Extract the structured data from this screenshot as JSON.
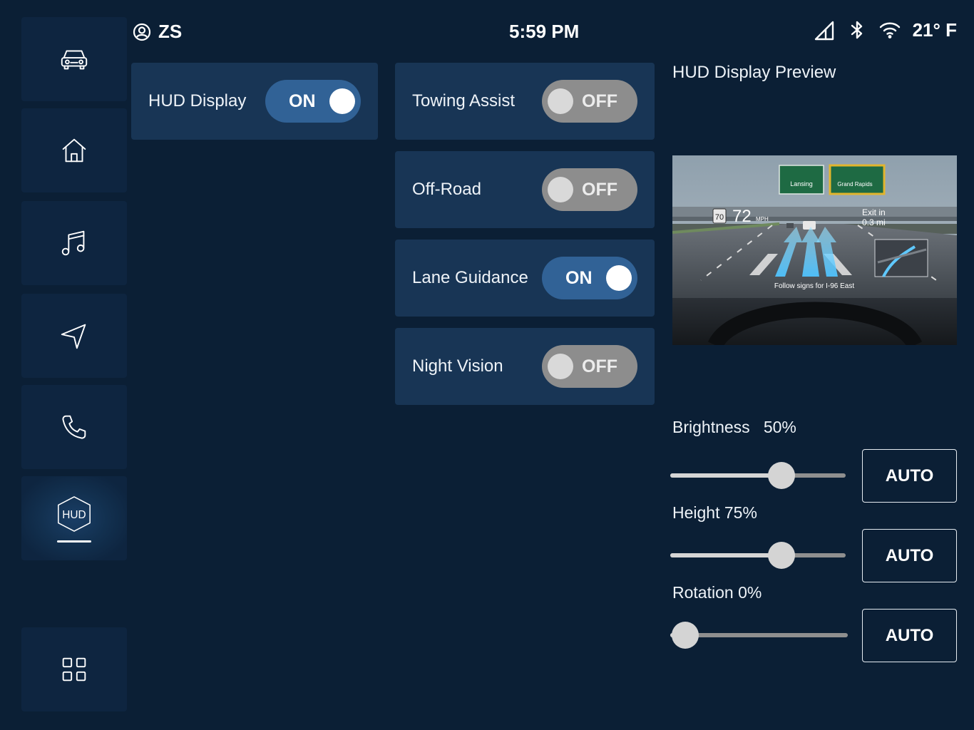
{
  "status_bar": {
    "user_initials": "ZS",
    "time": "5:59 PM",
    "temperature": "21° F"
  },
  "sidebar": {
    "items": [
      {
        "name": "car",
        "icon": "car-icon"
      },
      {
        "name": "home",
        "icon": "home-icon"
      },
      {
        "name": "music",
        "icon": "music-note-icon"
      },
      {
        "name": "navigation",
        "icon": "navigation-arrow-icon"
      },
      {
        "name": "phone",
        "icon": "phone-icon"
      },
      {
        "name": "hud",
        "icon": "hud-hexagon-icon",
        "label": "HUD",
        "active": true
      },
      {
        "name": "apps",
        "icon": "apps-grid-icon"
      }
    ]
  },
  "toggles": {
    "hud_display": {
      "label": "HUD Display",
      "state": "ON"
    },
    "towing_assist": {
      "label": "Towing Assist",
      "state": "OFF"
    },
    "off_road": {
      "label": "Off-Road",
      "state": "OFF"
    },
    "lane_guidance": {
      "label": "Lane Guidance",
      "state": "ON"
    },
    "night_vision": {
      "label": "Night Vision",
      "state": "OFF"
    }
  },
  "preview": {
    "title": "HUD Display Preview",
    "speed_limit": "70",
    "speed": "72",
    "speed_unit": "MPH",
    "exit_line1": "Exit in",
    "exit_line2": "0.3 mi",
    "sign_left": "Lansing",
    "sign_right": "Grand Rapids",
    "instruction": "Follow signs for I-96 East"
  },
  "sliders": {
    "brightness": {
      "label": "Brightness",
      "value_text": "50%",
      "level": 0.66,
      "auto_label": "AUTO"
    },
    "height": {
      "label": "Height",
      "value_text": "75%",
      "level": 0.66,
      "auto_label": "AUTO"
    },
    "rotation": {
      "label": "Rotation",
      "value_text": "0%",
      "level": 0.0,
      "auto_label": "AUTO"
    }
  },
  "colors": {
    "background": "#0b1f35",
    "card": "#183555",
    "toggle_on": "#316296",
    "toggle_off": "#8d8d8d"
  }
}
